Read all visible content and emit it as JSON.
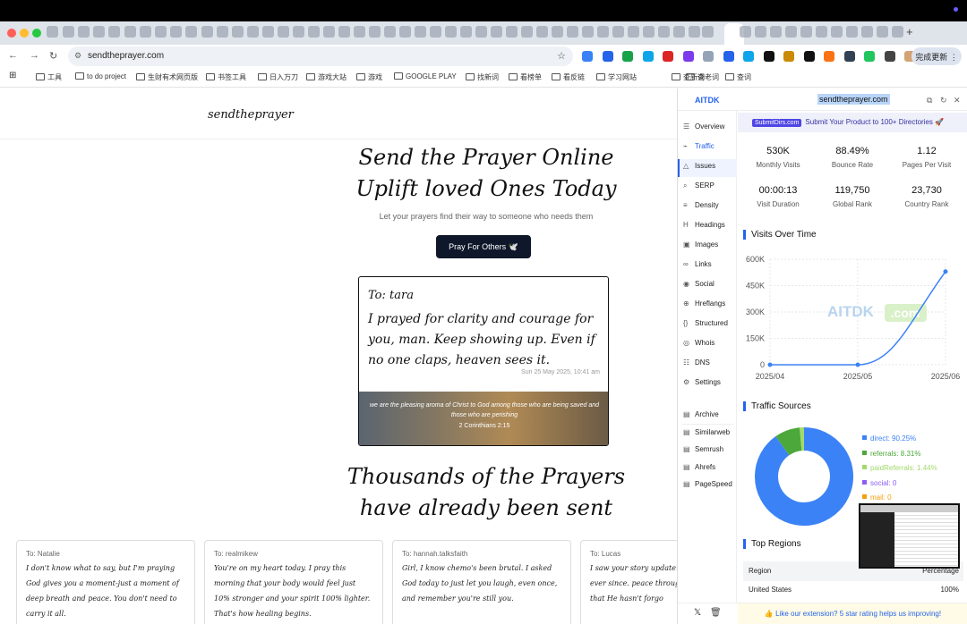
{
  "browser": {
    "url": "sendtheprayer.com",
    "update_label": "完成更新"
  },
  "bookmarks": [
    "工具",
    "to do project",
    "生财有术网页版",
    "书签工具",
    "日入万刀",
    "游戏大站",
    "游戏",
    "GOOGLE PLAY",
    "找新词",
    "看榜单",
    "看反链",
    "学习网站",
    "查新词",
    "查老词",
    "查词"
  ],
  "site": {
    "logo": "sendtheprayer",
    "hero_line1": "Send the Prayer Online",
    "hero_line2": "Uplift loved Ones Today",
    "subtitle": "Let your prayers find their way to someone who needs them",
    "cta": "Pray For Others 🕊️",
    "card": {
      "to": "To: tara",
      "message": "I prayed for clarity and courage for you, man. Keep showing up. Even if no one claps, heaven sees it.",
      "date": "Sun 25 May 2025, 10:41 am",
      "verse": "we are the pleasing aroma of Christ to God among those who are being saved and those who are perishing",
      "verse_ref": "2 Corinthians 2:15"
    },
    "section_line1": "Thousands of the Prayers",
    "section_line2": "have already been sent",
    "prayers": [
      {
        "to": "To: Natalie",
        "msg": "I don't know what to say, but I'm praying God gives you a moment-just a moment of deep breath and peace. You don't need to carry it all."
      },
      {
        "to": "To: realmikew",
        "msg": "You're on my heart today. I pray this morning that your body would feel just 10% stronger and your spirit 100% lighter. That's how healing begins."
      },
      {
        "to": "To: hannah.talksfaith",
        "msg": "Girl, I know chemo's been brutal. I asked God today to just let you laugh, even once, and remember you're still you."
      },
      {
        "to": "To: Lucas",
        "msg": "I saw your story update. praying for you ever since. peace through the pain a sign that He hasn't forgo"
      }
    ]
  },
  "panel": {
    "brand": "AITDK",
    "domain": "sendtheprayer.com",
    "nav": [
      "Overview",
      "Traffic",
      "Issues",
      "SERP",
      "Density",
      "Headings",
      "Images",
      "Links",
      "Social",
      "Hreflangs",
      "Structured",
      "Whois",
      "DNS",
      "Settings"
    ],
    "nav_icons": [
      "☰",
      "⌁",
      "△",
      "⌕",
      "≡",
      "H",
      "▣",
      "∞",
      "◉",
      "⊕",
      "{}",
      "◎",
      "☷",
      "⚙"
    ],
    "nav_ext": [
      "Archive",
      "Similarweb",
      "Semrush",
      "Ahrefs",
      "PageSpeed"
    ],
    "promo_badge": "SubmitDirs.com",
    "promo": "Submit Your Product to 100+ Directories",
    "stats": [
      {
        "value": "530K",
        "label": "Monthly Visits"
      },
      {
        "value": "88.49%",
        "label": "Bounce Rate"
      },
      {
        "value": "1.12",
        "label": "Pages Per Visit"
      },
      {
        "value": "00:00:13",
        "label": "Visit Duration"
      },
      {
        "value": "119,750",
        "label": "Global Rank"
      },
      {
        "value": "23,730",
        "label": "Country Rank"
      }
    ],
    "visits_title": "Visits Over Time",
    "watermark": "AITDK",
    "watermark_suffix": ".com",
    "sources_title": "Traffic Sources",
    "sources": [
      {
        "label": "direct: 90.25%",
        "value": 90.25,
        "color": "#3b82f6"
      },
      {
        "label": "referrals: 8.31%",
        "value": 8.31,
        "color": "#4ca83a"
      },
      {
        "label": "paidReferrals: 1.44%",
        "value": 1.44,
        "color": "#a3d96b"
      },
      {
        "label": "social: 0",
        "value": 0,
        "color": "#8b5cf6"
      },
      {
        "label": "mail: 0",
        "value": 0,
        "color": "#f59e0b"
      }
    ],
    "regions_title": "Top Regions",
    "regions_head": {
      "region": "Region",
      "pct": "Percentage"
    },
    "regions": [
      {
        "region": "United States",
        "pct": "100%"
      }
    ],
    "rating": "👍 Like our extension? 5 star rating helps us improving!"
  },
  "chart_data": {
    "type": "line",
    "x": [
      "2025/04",
      "2025/05",
      "2025/06"
    ],
    "y": [
      0,
      0,
      530000
    ],
    "yticks": [
      "0",
      "150K",
      "300K",
      "450K",
      "600K"
    ],
    "ylim": [
      0,
      600000
    ],
    "title": "Visits Over Time"
  }
}
